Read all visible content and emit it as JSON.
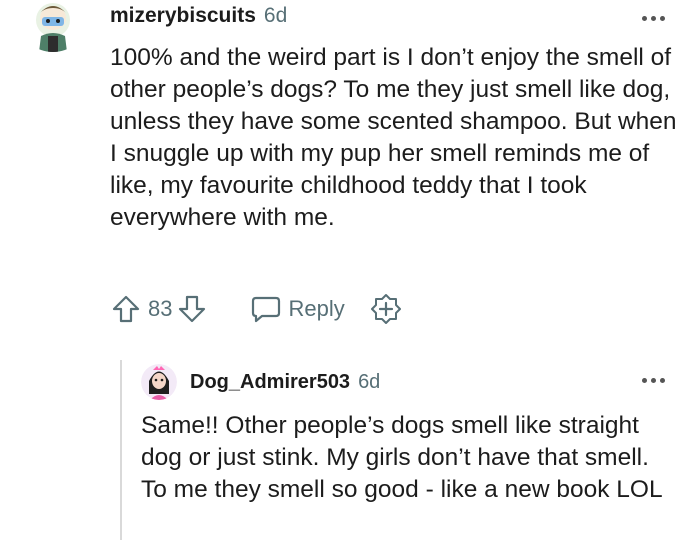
{
  "comment": {
    "username": "mizerybiscuits",
    "age": "6d",
    "body": "100% and the weird part is I don’t enjoy the smell of other people’s dogs? To me they just smell like dog, unless they have some scented shampoo. But when I snuggle up with my pup her smell reminds me of like, my favourite childhood teddy that I took everywhere with me.",
    "score": "83",
    "reply_label": "Reply"
  },
  "reply": {
    "username": "Dog_Admirer503",
    "age": "6d",
    "body": "Same!! Other people’s dogs smell like straight dog or just stink. My girls don’t have that smell. To me they smell so good - like a new book LOL"
  }
}
